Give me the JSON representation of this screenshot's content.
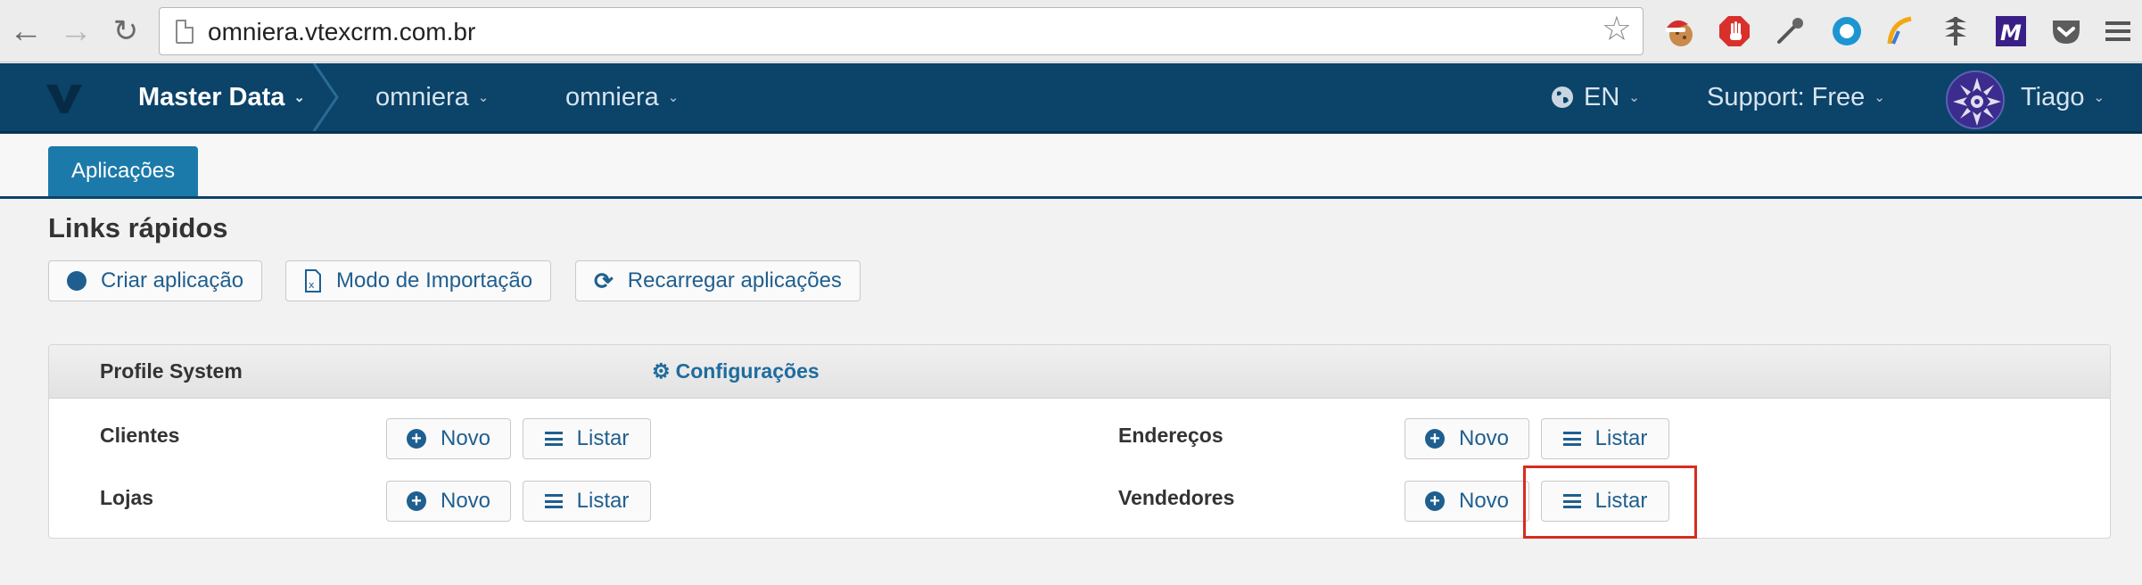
{
  "browser": {
    "url": "omniera.vtexcrm.com.br"
  },
  "header": {
    "breadcrumb": [
      {
        "label": "Master Data"
      },
      {
        "label": "omniera"
      },
      {
        "label": "omniera"
      }
    ],
    "language": "EN",
    "support": "Support: Free",
    "user": "Tiago"
  },
  "tabs": [
    {
      "label": "Aplicações"
    }
  ],
  "quick_links": {
    "title": "Links rápidos",
    "buttons": [
      {
        "label": "Criar aplicação",
        "icon": "plus-circle-icon"
      },
      {
        "label": "Modo de Importação",
        "icon": "excel-file-icon"
      },
      {
        "label": "Recarregar aplicações",
        "icon": "refresh-icon"
      }
    ]
  },
  "panel": {
    "title": "Profile System",
    "config_label": "Configurações",
    "entities": [
      {
        "name": "Clientes",
        "new_label": "Novo",
        "list_label": "Listar"
      },
      {
        "name": "Endereços",
        "new_label": "Novo",
        "list_label": "Listar"
      },
      {
        "name": "Lojas",
        "new_label": "Novo",
        "list_label": "Listar"
      },
      {
        "name": "Vendedores",
        "new_label": "Novo",
        "list_label": "Listar"
      }
    ]
  },
  "colors": {
    "header_bg": "#0b4369",
    "tab_active": "#1c7aaa",
    "link": "#1f5f8f",
    "highlight": "#d62d20"
  }
}
